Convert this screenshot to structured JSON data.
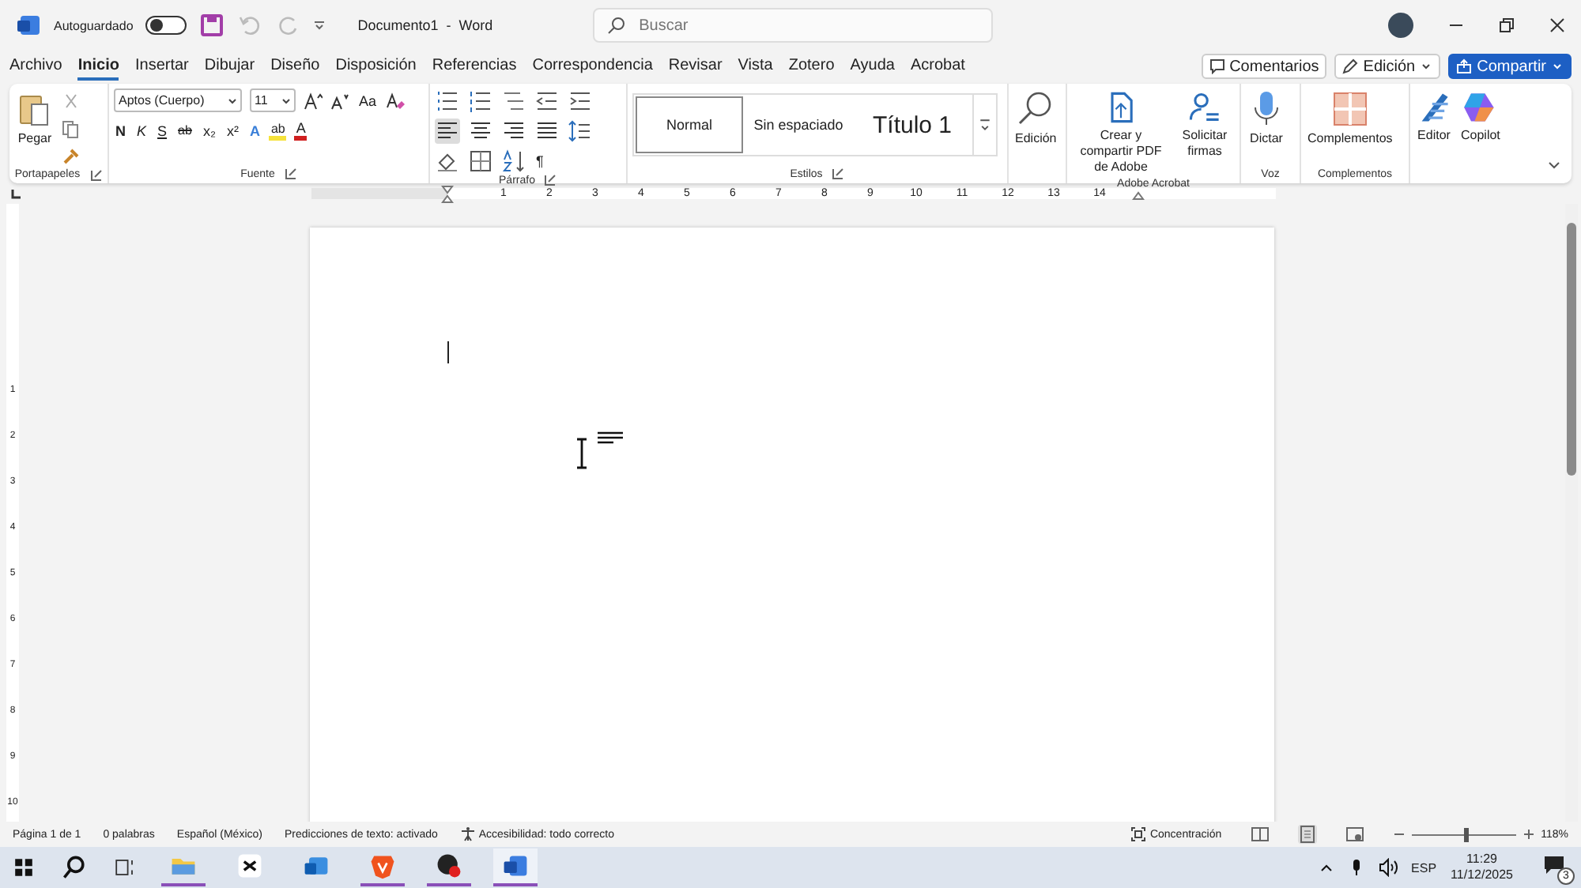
{
  "title_bar": {
    "autosave_label": "Autoguardado",
    "autosave_on": false,
    "title": "Documento1  -  Word",
    "search": {
      "placeholder": "Buscar"
    }
  },
  "tabs": [
    {
      "label": "Archivo",
      "selected": false
    },
    {
      "label": "Inicio",
      "selected": true
    },
    {
      "label": "Insertar",
      "selected": false
    },
    {
      "label": "Dibujar",
      "selected": false
    },
    {
      "label": "Diseño",
      "selected": false
    },
    {
      "label": "Disposición",
      "selected": false
    },
    {
      "label": "Referencias",
      "selected": false
    },
    {
      "label": "Correspondencia",
      "selected": false
    },
    {
      "label": "Revisar",
      "selected": false
    },
    {
      "label": "Vista",
      "selected": false
    },
    {
      "label": "Zotero",
      "selected": false
    },
    {
      "label": "Ayuda",
      "selected": false
    },
    {
      "label": "Acrobat",
      "selected": false
    }
  ],
  "header_buttons": [
    {
      "kind": "comments",
      "label": "Comentarios"
    },
    {
      "kind": "editing",
      "label": "Edición"
    },
    {
      "kind": "share",
      "label": "Compartir"
    }
  ],
  "ribbon": {
    "clipboard": {
      "paste": "Pegar",
      "label": "Portapapeles"
    },
    "font": {
      "family": "Aptos (Cuerpo)",
      "size": "11",
      "case_button": "Aa",
      "format_buttons": [
        "N",
        "K",
        "S"
      ],
      "strike": "ab",
      "subscript": "x₂",
      "superscript": "x²",
      "effects": "A",
      "highlight": "ab",
      "font_color_button": "A",
      "label": "Fuente"
    },
    "paragraph": {
      "marks": "¶",
      "label": "Párrafo"
    },
    "styles": {
      "items": [
        {
          "label": "Normal",
          "selected": true
        },
        {
          "label": "Sin espaciado",
          "selected": false
        },
        {
          "label": "Título 1",
          "selected": false
        }
      ],
      "label": "Estilos"
    },
    "editing": {
      "label": "Edición"
    },
    "acrobat": {
      "buttons": [
        {
          "kind": "pdf",
          "label": "Crear y compartir PDF de Adobe"
        },
        {
          "kind": "sign",
          "label": "Solicitar firmas"
        }
      ],
      "label": "Adobe Acrobat"
    },
    "voice": {
      "button": "Dictar",
      "label": "Voz"
    },
    "addins": {
      "button": "Complementos",
      "label": "Complementos"
    },
    "assist": [
      {
        "kind": "editor",
        "label": "Editor"
      },
      {
        "kind": "copilot",
        "label": "Copilot"
      }
    ]
  },
  "ruler": {
    "numbers": [
      "1",
      "2",
      "3",
      "4",
      "5",
      "6",
      "7",
      "8",
      "9",
      "10",
      "11",
      "12",
      "13",
      "14"
    ]
  },
  "vertical_ruler": {
    "numbers": [
      "1",
      "2",
      "3",
      "4",
      "5",
      "6",
      "7",
      "8",
      "9",
      "10"
    ]
  },
  "status_bar": {
    "items": [
      "Página 1 de 1",
      "0 palabras",
      "Español (México)",
      "Predicciones de texto: activado"
    ],
    "accessibility": "Accesibilidad: todo correcto",
    "focus": "Concentración",
    "zoom": {
      "level": 0.52,
      "reading": "118%"
    }
  },
  "taskbar": {
    "apps": [
      {
        "kind": "folder",
        "running": true,
        "selected": false
      },
      {
        "kind": "editor",
        "running": false,
        "selected": false
      },
      {
        "kind": "mail",
        "running": false,
        "selected": false
      },
      {
        "kind": "browser",
        "running": true,
        "selected": false
      },
      {
        "kind": "recorder",
        "running": true,
        "selected": false
      },
      {
        "kind": "word",
        "running": true,
        "selected": true
      }
    ],
    "language": "ESP",
    "time": "11:29",
    "date": "11/12/2025",
    "notifications": "3"
  }
}
